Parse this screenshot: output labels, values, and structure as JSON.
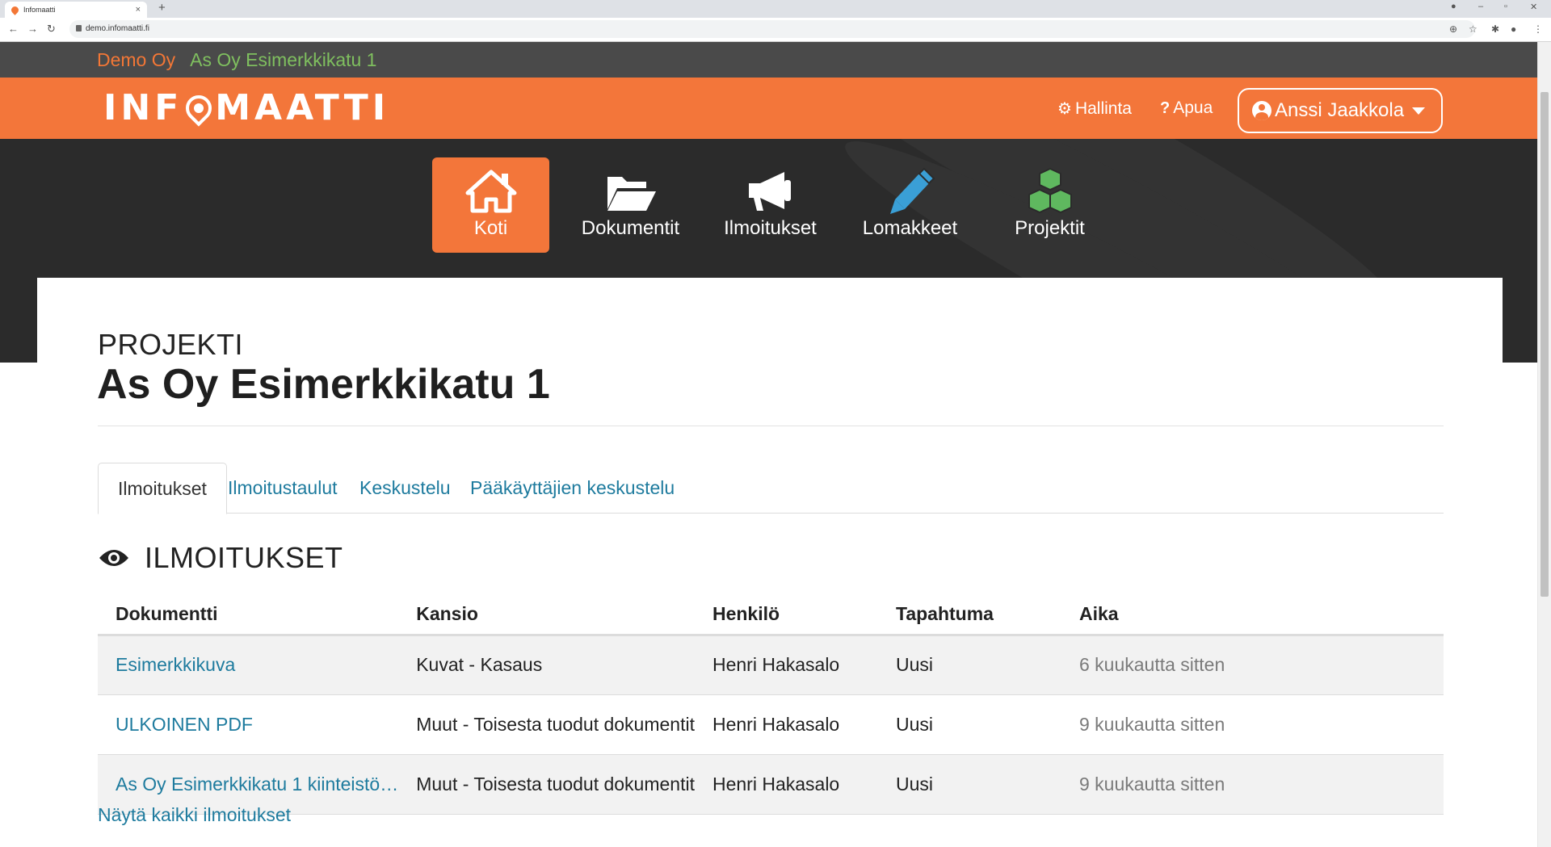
{
  "browser": {
    "tab_title": "Infomaatti",
    "url": "demo.infomaatti.fi"
  },
  "colors": {
    "brand_orange": "#f3763a",
    "org_orange": "#f37736",
    "property_green": "#7fbf5f",
    "link_blue": "#1e7b9e",
    "dark_hero": "#2b2b2b"
  },
  "orgbar": {
    "organization": "Demo Oy",
    "property": "As Oy Esimerkkikatu 1"
  },
  "header": {
    "logo_text_left": "INF",
    "logo_text_right": "MAATTI",
    "admin_label": "Hallinta",
    "help_label": "Apua",
    "user_name": "Anssi Jaakkola"
  },
  "mainnav": {
    "items": [
      {
        "label": "Koti",
        "icon": "home-icon",
        "active": true
      },
      {
        "label": "Dokumentit",
        "icon": "folder-open-icon",
        "active": false
      },
      {
        "label": "Ilmoitukset",
        "icon": "megaphone-icon",
        "active": false
      },
      {
        "label": "Lomakkeet",
        "icon": "pencil-icon",
        "active": false
      },
      {
        "label": "Projektit",
        "icon": "cubes-icon",
        "active": false
      }
    ]
  },
  "page": {
    "kicker": "PROJEKTI",
    "title": "As Oy Esimerkkikatu 1",
    "tabs": [
      {
        "label": "Ilmoitukset",
        "active": true
      },
      {
        "label": "Ilmoitustaulut",
        "active": false
      },
      {
        "label": "Keskustelu",
        "active": false
      },
      {
        "label": "Pääkäyttäjien keskustelu",
        "active": false
      }
    ],
    "section_title": "ILMOITUKSET",
    "section_icon": "eye-icon",
    "table": {
      "columns": [
        "Dokumentti",
        "Kansio",
        "Henkilö",
        "Tapahtuma",
        "Aika"
      ],
      "rows": [
        {
          "document": "Esimerkkikuva",
          "folder": "Kuvat - Kasaus",
          "person": "Henri Hakasalo",
          "event": "Uusi",
          "time": "6 kuukautta sitten"
        },
        {
          "document": "ULKOINEN PDF",
          "folder": "Muut - Toisesta tuodut dokumentit",
          "person": "Henri Hakasalo",
          "event": "Uusi",
          "time": "9 kuukautta sitten"
        },
        {
          "document": "As Oy Esimerkkikatu 1 kiinteistö…",
          "folder": "Muut - Toisesta tuodut dokumentit",
          "person": "Henri Hakasalo",
          "event": "Uusi",
          "time": "9 kuukautta sitten"
        }
      ]
    },
    "show_all_label": "Näytä kaikki ilmoitukset"
  }
}
